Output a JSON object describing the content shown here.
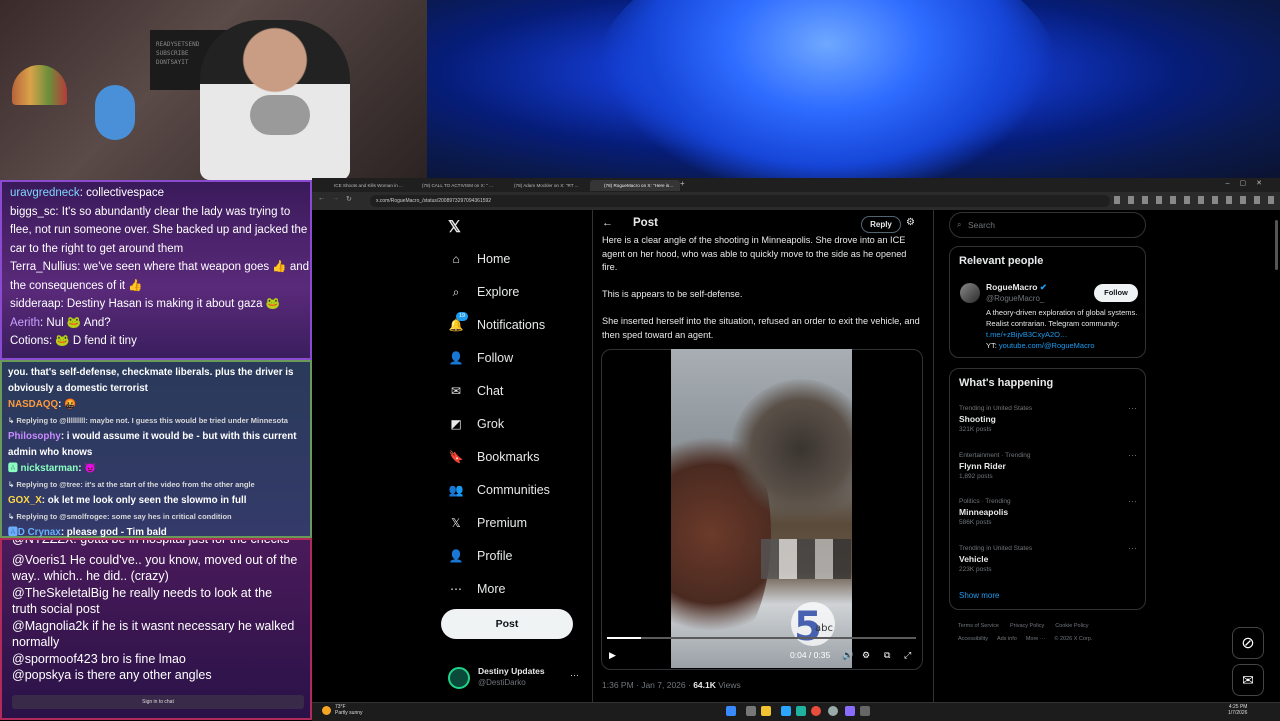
{
  "webcam": {
    "poster_text": "READYSETSEND\nSUBSCRIBE\nDONTSAYIT"
  },
  "chat_top": [
    {
      "user": "uravgredneck",
      "msg": ": collectivespace",
      "color": "#7fd4ff"
    },
    {
      "user": "biggs_sc",
      "msg": ": It's so abundantly clear the lady was trying to",
      "color": "#ffffff"
    },
    {
      "user": "",
      "msg": "flee, not run someone over. She backed up and jacked the",
      "color": "#ffffff"
    },
    {
      "user": "",
      "msg": "car to the right to get around them",
      "color": "#ffffff"
    },
    {
      "user": "Terra_Nullius",
      "msg": ": we've seen where that weapon goes 👍 and",
      "color": "#ffffff"
    },
    {
      "user": "",
      "msg": "the consequences of it 👍",
      "color": "#ffffff"
    },
    {
      "user": "sidderaap",
      "msg": ": Destiny Hasan is making it about gaza 🐸",
      "color": "#ffffff"
    },
    {
      "user": "Aerith",
      "msg": ": Nul 🐸 And?",
      "color": "#c8a0ff"
    },
    {
      "user": "Cotions",
      "msg": ": 🐸 D fend it tiny",
      "color": "#ffffff"
    }
  ],
  "chat_mid": [
    {
      "type": "line",
      "user": "",
      "msg": "you. that's self-defense, checkmate liberals. plus the driver is",
      "color": "#ffffff"
    },
    {
      "type": "line",
      "user": "",
      "msg": "obviously a domestic terrorist",
      "color": "#ffffff"
    },
    {
      "type": "line",
      "user": "NASDAQQ",
      "msg": ": 🤬",
      "color": "#ff9a3c"
    },
    {
      "type": "reply",
      "msg": "↳ Replying to @lllllllll: maybe not. I guess this would be tried under Minnesota"
    },
    {
      "type": "line",
      "user": "Philosophy",
      "msg": ": i would assume it would be - but with this current",
      "color": "#c88aff"
    },
    {
      "type": "line",
      "user": "",
      "msg": "admin who knows",
      "color": "#ffffff"
    },
    {
      "type": "line",
      "user": "🅰 nickstarman",
      "msg": ": 😈",
      "color": "#8affc0"
    },
    {
      "type": "reply",
      "msg": "↳ Replying to @tree: it's at the start of the video from the other angle"
    },
    {
      "type": "line",
      "user": "GOX_X",
      "msg": ": ok let me look only seen the slowmo in full",
      "color": "#ffd84a"
    },
    {
      "type": "reply",
      "msg": "↳ Replying to @smolfrogee: some say hes in critical condition"
    },
    {
      "type": "line",
      "user": "🅰D Crynax",
      "msg": ": please god - Tim bald",
      "color": "#6ab0ff"
    }
  ],
  "chat_bottom": [
    "@Voeris1 He could've.. you know, moved out of the way.. which.. he did.. (crazy)",
    "@TheSkeletalBig he really needs to look at the truth social post",
    "@Magnolia2k if he is it wasnt necessary he walked normally",
    "@spormoof423 bro is fine lmao",
    "@popskya is there any other angles"
  ],
  "chat_bottom_partial": "@NYZZZX: gotta be in hospital just for the checks",
  "signin_label": "Sign in to chat",
  "browser": {
    "tabs": [
      {
        "label": "ICE Shoots and Kills Woman in ...",
        "active": false
      },
      {
        "label": "(78) CALL TO ACTIVISM on X: \" ...",
        "active": false
      },
      {
        "label": "(78) Adam Mockler on X: \"RT ...",
        "active": false
      },
      {
        "label": "(78) RogueMacro on X: \"Here is...",
        "active": true
      }
    ],
    "url": "x.com/RogueMacro_/status/2008973297094361592"
  },
  "x_nav": {
    "items": [
      {
        "label": "Home",
        "icon": "home-icon"
      },
      {
        "label": "Explore",
        "icon": "search-icon"
      },
      {
        "label": "Notifications",
        "icon": "bell-icon",
        "badge": "19"
      },
      {
        "label": "Follow",
        "icon": "person-add-icon"
      },
      {
        "label": "Chat",
        "icon": "mail-icon"
      },
      {
        "label": "Grok",
        "icon": "grok-icon"
      },
      {
        "label": "Bookmarks",
        "icon": "bookmark-icon"
      },
      {
        "label": "Communities",
        "icon": "people-icon"
      },
      {
        "label": "Premium",
        "icon": "x-logo-icon"
      },
      {
        "label": "Profile",
        "icon": "person-icon"
      },
      {
        "label": "More",
        "icon": "more-circle-icon"
      }
    ],
    "post_button": "Post",
    "account_name": "Destiny Updates",
    "account_handle": "@DestiDarko"
  },
  "post": {
    "header": "Post",
    "reply_button": "Reply",
    "para1": "Here is a clear angle of the shooting in Minneapolis. She drove into an ICE agent on her hood, who was able to quickly move to the side as he opened fire.",
    "para2": "This is appears to be self-defense.",
    "para3": "She inserted herself into the situation, refused an order to exit the vehicle, and then sped toward an agent.",
    "video_time": "0:04 / 0:35",
    "video_progress": 0.11,
    "timestamp": "1:36 PM · Jan 7, 2026 · ",
    "views_count": "64.1K",
    "views_label": " Views"
  },
  "right": {
    "search_placeholder": "Search",
    "relevant_title": "Relevant people",
    "person_name": "RogueMacro",
    "person_handle": "@RogueMacro_",
    "follow_button": "Follow",
    "bio": "A theory-driven exploration of global systems. Realist contrarian. Telegram community: ",
    "bio_link": "t.me/+zBijvB3CxyA2O…",
    "bio_yt_label": "YT: ",
    "bio_yt": "youtube.com/@RogueMacro",
    "happening_title": "What's happening",
    "trends": [
      {
        "meta": "Trending in United States",
        "title": "Shooting",
        "count": "321K posts"
      },
      {
        "meta": "Entertainment · Trending",
        "title": "Flynn Rider",
        "count": "1,892 posts"
      },
      {
        "meta": "Politics · Trending",
        "title": "Minneapolis",
        "count": "586K posts"
      },
      {
        "meta": "Trending in United States",
        "title": "Vehicle",
        "count": "223K posts"
      }
    ],
    "show_more": "Show more",
    "footer_row1": [
      "Terms of Service",
      "Privacy Policy",
      "Cookie Policy"
    ],
    "footer_row2": [
      "Accessibility",
      "Ads info",
      "More ···",
      "© 2026 X Corp."
    ]
  },
  "taskbar": {
    "weather_temp": "73°F",
    "weather_desc": "Partly sunny",
    "time": "4:25 PM",
    "date": "1/7/2026"
  },
  "colors": {
    "x_link": "#1d9bf0",
    "verified": "#1d9bf0"
  }
}
